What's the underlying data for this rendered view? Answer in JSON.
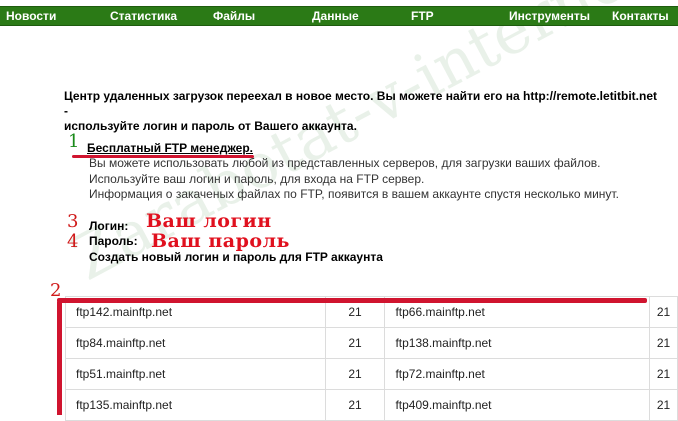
{
  "nav": {
    "items": [
      "Новости",
      "Статистика",
      "Файлы",
      "Данные",
      "FTP",
      "Инструменты",
      "Контакты"
    ]
  },
  "notice": {
    "line1": "Центр удаленных загрузок переехал в новое место. Вы можете найти его на http://remote.letitbit.net -",
    "line2": "используйте логин и пароль от Вашего аккаунта."
  },
  "section": {
    "title": "Бесплатный FTP менеджер.",
    "desc": [
      "Вы можете использовать любой из представленных серверов, для загрузки ваших файлов.",
      "Используйте ваш логин и пароль, для входа на FTP сервер.",
      "Информация о закаченых файлах по FTP, появится в вашем аккаунте спустя несколько минут."
    ]
  },
  "markers": {
    "m1": "1",
    "m2": "2",
    "m3": "3",
    "m4": "4"
  },
  "login": {
    "label": "Логин:",
    "value": "Ваш логин"
  },
  "password": {
    "label": "Пароль:",
    "value": "Ваш пароль"
  },
  "create_link": "Создать новый логин и пароль для FTP аккаунта",
  "servers": [
    {
      "host1": "ftp142.mainftp.net",
      "port1": "21",
      "host2": "ftp66.mainftp.net",
      "port2": "21"
    },
    {
      "host1": "ftp84.mainftp.net",
      "port1": "21",
      "host2": "ftp138.mainftp.net",
      "port2": "21"
    },
    {
      "host1": "ftp51.mainftp.net",
      "port1": "21",
      "host2": "ftp72.mainftp.net",
      "port2": "21"
    },
    {
      "host1": "ftp135.mainftp.net",
      "port1": "21",
      "host2": "ftp409.mainftp.net",
      "port2": "21"
    }
  ],
  "watermark": "Zarabotat-v-internet.ru",
  "colors": {
    "nav_bg": "#2b7a16",
    "annotation_red": "#d0142f",
    "marker_green": "#1a8a1a"
  }
}
